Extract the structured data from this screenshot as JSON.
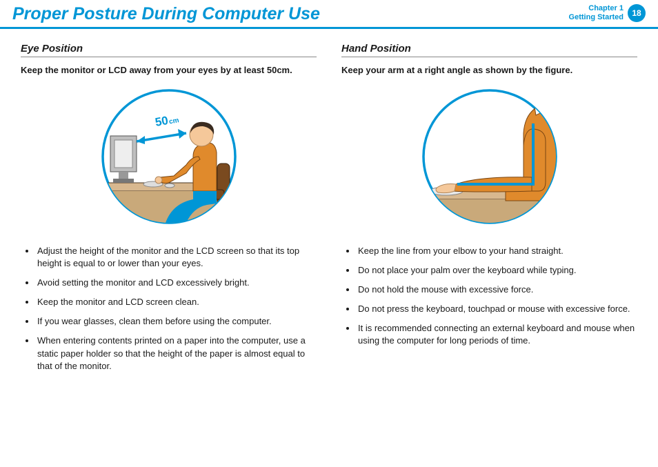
{
  "header": {
    "title": "Proper Posture During Computer Use",
    "chapter_line1": "Chapter 1",
    "chapter_line2": "Getting Started",
    "page_number": "18"
  },
  "eye": {
    "heading": "Eye Position",
    "lead": "Keep the monitor or LCD away from your eyes by at least 50cm.",
    "distance_label": "50",
    "distance_unit": "cm",
    "bullets": [
      "Adjust the height of the monitor and the LCD screen so that its top height is equal to or lower than your eyes.",
      "Avoid setting the monitor and LCD excessively bright.",
      "Keep the monitor and LCD screen clean.",
      "If you wear glasses, clean them before using the computer.",
      "When entering contents printed on a paper into the computer, use a static paper holder so that the height of the paper is almost equal to that of the monitor."
    ]
  },
  "hand": {
    "heading": "Hand Position",
    "lead": "Keep your arm at a right angle as shown by the figure.",
    "bullets": [
      "Keep the line from your elbow to your hand straight.",
      "Do not place your palm over the keyboard while typing.",
      "Do not hold the mouse with excessive force.",
      "Do not press the keyboard, touchpad or mouse with excessive force.",
      "It is recommended connecting an external keyboard and mouse when using the computer for long periods of time."
    ]
  },
  "colors": {
    "accent": "#0096d6",
    "skin": "#f5c89a",
    "hair": "#3a2b20",
    "shirt": "#e08a2c",
    "shirt_dark": "#b56a1a",
    "chair": "#7a4a1f",
    "desk": "#d8b88f",
    "monitor": "#bfbfbf"
  }
}
